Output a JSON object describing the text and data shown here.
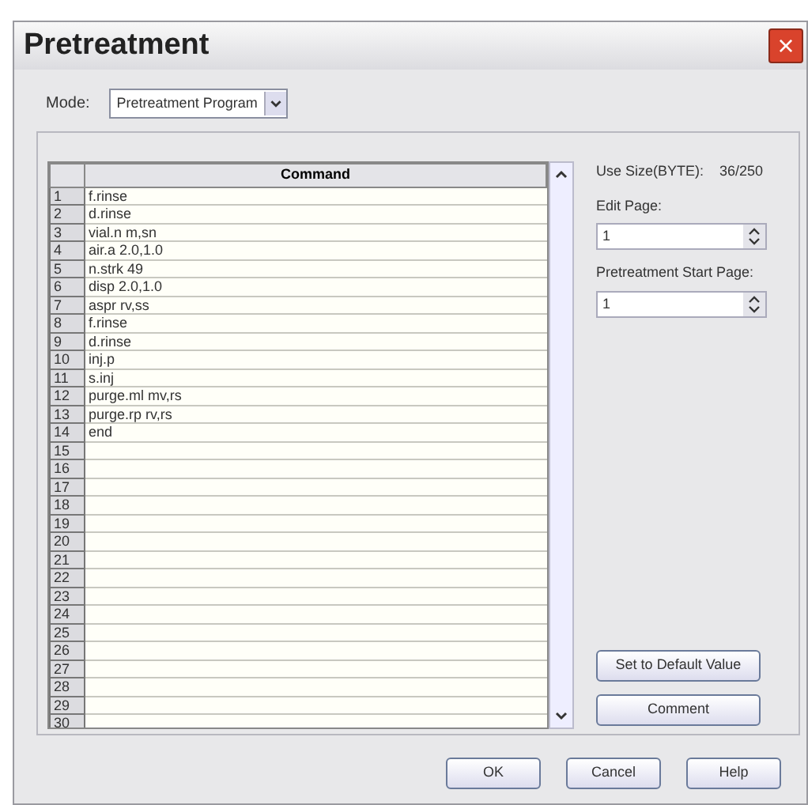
{
  "window": {
    "title": "Pretreatment",
    "close": "×"
  },
  "mode": {
    "label": "Mode:",
    "value": "Pretreatment Program"
  },
  "table": {
    "columns": [
      "",
      "Command"
    ],
    "rows": [
      [
        "1",
        "f.rinse"
      ],
      [
        "2",
        "d.rinse"
      ],
      [
        "3",
        "vial.n m,sn"
      ],
      [
        "4",
        "air.a 2.0,1.0"
      ],
      [
        "5",
        "n.strk 49"
      ],
      [
        "6",
        "disp 2.0,1.0"
      ],
      [
        "7",
        "aspr rv,ss"
      ],
      [
        "8",
        "f.rinse"
      ],
      [
        "9",
        "d.rinse"
      ],
      [
        "10",
        "inj.p"
      ],
      [
        "11",
        "s.inj"
      ],
      [
        "12",
        "purge.ml mv,rs"
      ],
      [
        "13",
        "purge.rp rv,rs"
      ],
      [
        "14",
        "end"
      ],
      [
        "15",
        ""
      ],
      [
        "16",
        ""
      ],
      [
        "17",
        ""
      ],
      [
        "18",
        ""
      ],
      [
        "19",
        ""
      ],
      [
        "20",
        ""
      ],
      [
        "21",
        ""
      ],
      [
        "22",
        ""
      ],
      [
        "23",
        ""
      ],
      [
        "24",
        ""
      ],
      [
        "25",
        ""
      ],
      [
        "26",
        ""
      ],
      [
        "27",
        ""
      ],
      [
        "28",
        ""
      ],
      [
        "29",
        ""
      ],
      [
        "30",
        ""
      ]
    ]
  },
  "use_size": {
    "label": "Use Size(BYTE):",
    "value": "36/250"
  },
  "edit_page": {
    "label": "Edit Page:",
    "value": "1"
  },
  "start_page": {
    "label": "Pretreatment Start Page:",
    "value": "1"
  },
  "side_buttons": [
    "Set to Default Value",
    "Comment"
  ],
  "buttons": [
    "OK",
    "Cancel",
    "Help"
  ]
}
